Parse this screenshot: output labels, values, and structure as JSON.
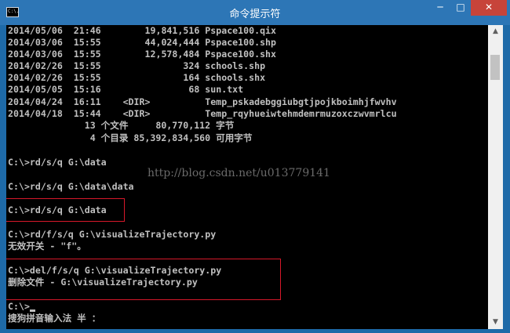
{
  "window": {
    "title": "命令提示符",
    "icon_label": "C:\\.",
    "controls": {
      "minimize": "─",
      "maximize": "□",
      "close": "✕"
    }
  },
  "console": {
    "lines": [
      "2014/05/06  21:46        19,841,516 Pspace100.qix",
      "2014/03/06  15:55        44,024,444 Pspace100.shp",
      "2014/03/06  15:55        12,578,484 Pspace100.shx",
      "2014/02/26  15:55               324 schools.shp",
      "2014/02/26  15:55               164 schools.shx",
      "2014/05/05  15:16                68 sun.txt",
      "2014/04/24  16:11    <DIR>          Temp_pskadebggiubgtjpojkboimhjfwvhv",
      "2014/04/18  15:44    <DIR>          Temp_rqyhueiwtehmdemrmuzoxczwvmrlcu",
      "              13 个文件     80,770,112 字节",
      "               4 个目录 85,392,834,560 可用字节",
      "",
      "C:\\>rd/s/q G:\\data",
      "",
      "C:\\>rd/s/q G:\\data\\data",
      "",
      "C:\\>rd/s/q G:\\data",
      "",
      "C:\\>rd/f/s/q G:\\visualizeTrajectory.py",
      "无效开关 - \"f\"。",
      "",
      "C:\\>del/f/s/q G:\\visualizeTrajectory.py",
      "删除文件 - G:\\visualizeTrajectory.py",
      "",
      "C:\\>",
      "搜狗拼音输入法 半 ："
    ],
    "watermark": "http://blog.csdn.net/u013779141"
  },
  "scrollbar": {
    "up_arrow": "▲",
    "down_arrow": "▼"
  }
}
